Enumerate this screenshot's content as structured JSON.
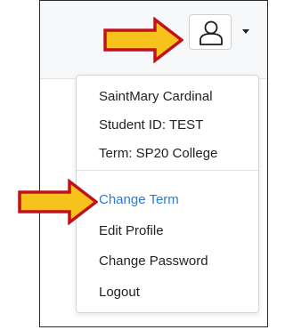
{
  "user_menu": {
    "info": [
      "SaintMary Cardinal",
      "Student ID: TEST",
      "Term: SP20 College"
    ],
    "actions": [
      "Change Term",
      "Edit Profile",
      "Change Password",
      "Logout"
    ],
    "highlighted_action": "Change Term"
  },
  "icons": {
    "user_button": "user-outline-icon",
    "dropdown": "chevron-down-icon",
    "annotation": "arrow-right-icon"
  },
  "colors": {
    "annotation_fill": "#f7c21b",
    "annotation_border": "#c0121c",
    "link": "#2e7ad6"
  }
}
